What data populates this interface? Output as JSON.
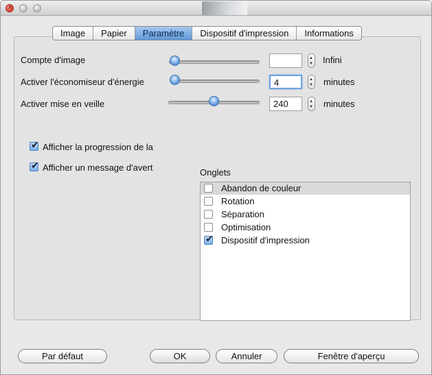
{
  "tabs": [
    "Image",
    "Papier",
    "Paramètre",
    "Dispositif d'impression",
    "Informations"
  ],
  "active_tab": "Paramètre",
  "settings": {
    "image_count": {
      "label": "Compte d'image",
      "value": "",
      "unit": "Infini",
      "slider_level": 0.0
    },
    "energy_saver": {
      "label": "Activer l'économiseur d'énergie",
      "value": "4",
      "unit": "minutes",
      "slider_level": 0.0
    },
    "sleep_mode": {
      "label": "Activer mise en veille",
      "value": "240",
      "unit": "minutes",
      "slider_level": 0.5
    }
  },
  "checkboxes": {
    "show_progress": {
      "label": "Afficher la progression de la",
      "checked": true
    },
    "show_warning": {
      "label": "Afficher un message d'avert",
      "checked": true
    }
  },
  "onglets": {
    "title": "Onglets",
    "items": [
      {
        "label": "Abandon de couleur",
        "checked": false,
        "selected": true
      },
      {
        "label": "Rotation",
        "checked": false,
        "selected": false
      },
      {
        "label": "Séparation",
        "checked": false,
        "selected": false
      },
      {
        "label": "Optimisation",
        "checked": false,
        "selected": false
      },
      {
        "label": "Dispositif d'impression",
        "checked": true,
        "selected": false
      }
    ]
  },
  "buttons": {
    "default": "Par défaut",
    "ok": "OK",
    "cancel": "Annuler",
    "preview": "Fenêtre d'aperçu"
  },
  "icons": {
    "close": "close-icon",
    "minimize": "minimize-icon",
    "zoom": "zoom-icon",
    "checkmark": "checkmark-icon",
    "stepper_up": "chevron-up-icon",
    "stepper_down": "chevron-down-icon"
  },
  "colors": {
    "accent": "#5e97d8",
    "window_bg": "#e8e8e8",
    "close_red": "#d63a2a"
  }
}
